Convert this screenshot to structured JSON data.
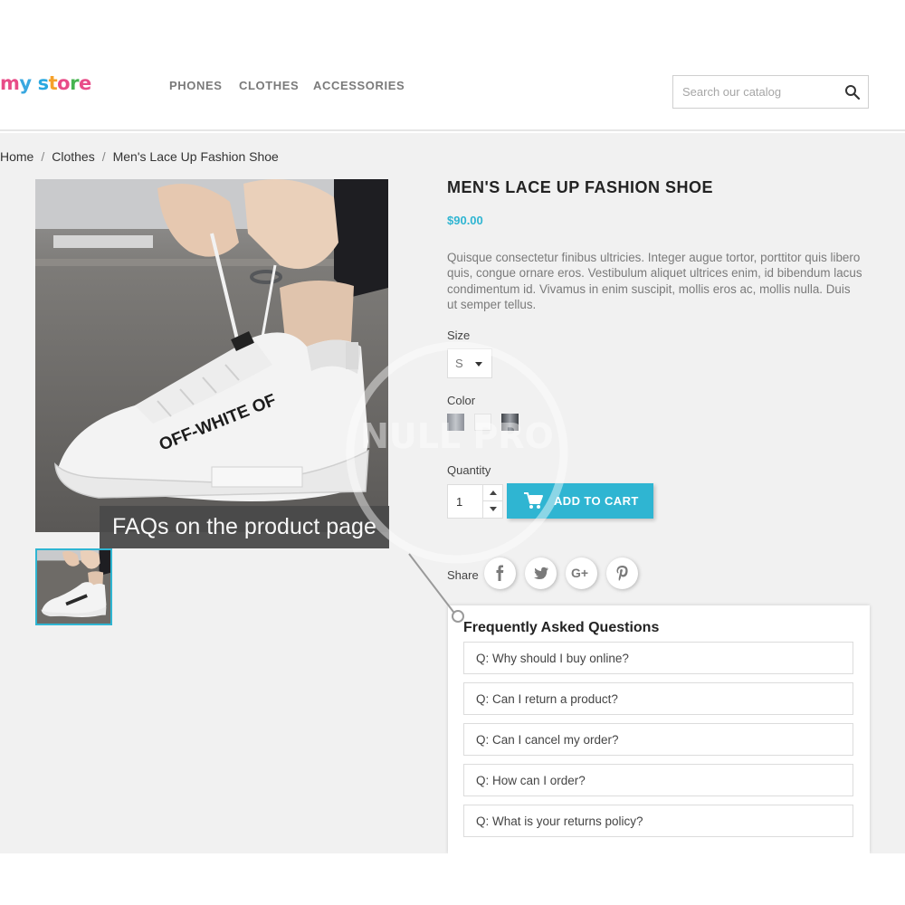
{
  "header": {
    "logo": {
      "letters": [
        "m",
        "y",
        " ",
        "s",
        "t",
        "o",
        "r",
        "e"
      ],
      "colors": [
        "#e84c88",
        "#3aa8e0",
        "#000000",
        "#29a8e0",
        "#f6a12a",
        "#e84c88",
        "#46b450",
        "#e84c88"
      ]
    },
    "nav": [
      {
        "label": "PHONES"
      },
      {
        "label": "CLOTHES"
      },
      {
        "label": "ACCESSORIES"
      }
    ],
    "search": {
      "placeholder": "Search our catalog",
      "icon": "search-icon"
    }
  },
  "breadcrumb": [
    "Home",
    "Clothes",
    "Men's Lace Up Fashion Shoe"
  ],
  "image": {
    "main_alt": "white sneaker being laced",
    "shoe_text": "OFF-WHITE OF",
    "caption": "FAQs on the product page",
    "watermark": "NULL PRO"
  },
  "product": {
    "title": "MEN'S LACE UP FASHION SHOE",
    "price": "$90.00",
    "description": "Quisque consectetur finibus ultricies. Integer augue tortor, porttitor quis libero quis, congue ornare eros. Vestibulum aliquet ultrices enim, id bibendum lacus condimentum id. Vivamus in enim suscipit, mollis eros ac, mollis nulla. Duis ut semper tellus.",
    "size_label": "Size",
    "size_value": "S",
    "color_label": "Color",
    "colors": [
      "#a9adb4",
      "#f5f5f5",
      "#5c6066"
    ],
    "quantity_label": "Quantity",
    "quantity_value": "1",
    "add_to_cart": "ADD TO CART",
    "share_label": "Share",
    "social": [
      "facebook-icon",
      "twitter-icon",
      "google-plus-icon",
      "pinterest-icon"
    ],
    "google_plus_text": "G+"
  },
  "faq": {
    "title": "Frequently Asked Questions",
    "items": [
      "Q: Why should I buy online?",
      "Q: Can I return a product?",
      "Q: Can I cancel my order?",
      "Q: How can I order?",
      "Q: What is your returns policy?"
    ]
  },
  "colors": {
    "accent": "#2fb5d2",
    "background": "#f1f1f1",
    "caption_bg": "#4a4a4a"
  }
}
